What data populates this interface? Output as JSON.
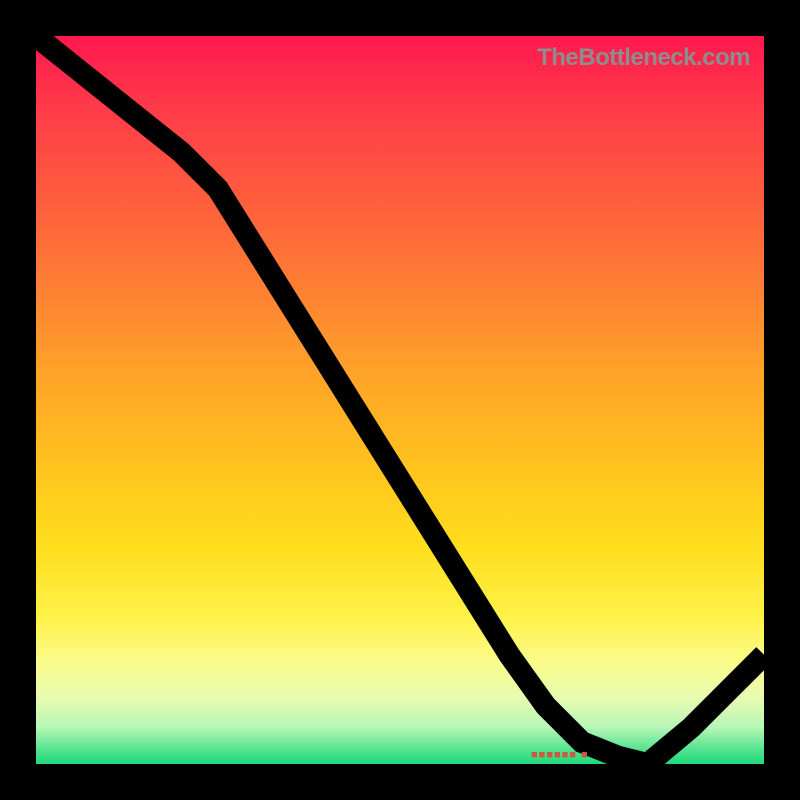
{
  "attribution": "TheBottleneck.com",
  "obscured_tick_text": "■■■■■■ ■",
  "colors": {
    "frame": "#000000",
    "curve": "#000000",
    "attribution": "#8d8d8d",
    "gradient_top": "#ff184d",
    "gradient_bottom": "#1fd87b"
  },
  "chart_data": {
    "type": "line",
    "title": "",
    "xlabel": "",
    "ylabel": "",
    "xlim": [
      0,
      100
    ],
    "ylim": [
      0,
      100
    ],
    "series": [
      {
        "name": "curve",
        "x": [
          0,
          5,
          10,
          15,
          20,
          25,
          30,
          35,
          40,
          45,
          50,
          55,
          60,
          65,
          70,
          75,
          80,
          84,
          90,
          95,
          100
        ],
        "y": [
          100,
          96,
          92,
          88,
          84,
          79,
          71,
          63,
          55,
          47,
          39,
          31,
          23,
          15,
          8,
          3,
          1,
          0,
          5,
          10,
          15
        ]
      }
    ],
    "notes": "Gradient background from red (high bottleneck) at top to green (no bottleneck) at bottom. Black curve descends from top-left, reaches minimum near x≈84, then rises toward bottom-right corner. Axis tick labels and titles are not visible in the image."
  }
}
